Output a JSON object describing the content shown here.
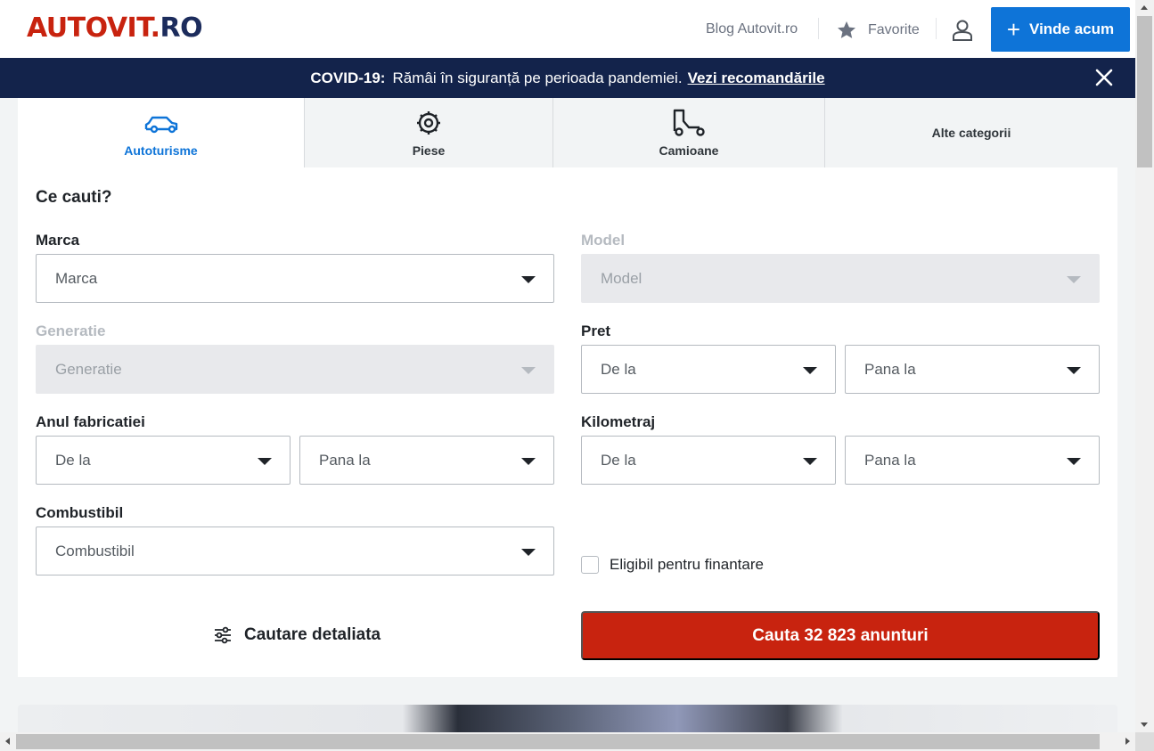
{
  "header": {
    "logo_part1": "AUTOVIT.",
    "logo_part2": "RO",
    "blog_link": "Blog Autovit.ro",
    "favorites": "Favorite",
    "sell_button": "Vinde acum",
    "sell_icon": "plus-icon",
    "favorites_icon": "star-icon",
    "account_icon": "user-icon"
  },
  "banner": {
    "label": "COVID-19:",
    "text": "Rămâi în siguranță pe perioada pandemiei.",
    "link": "Vezi recomandările",
    "close_icon": "close-icon"
  },
  "tabs": [
    {
      "label": "Autoturisme",
      "icon": "car-icon",
      "active": true
    },
    {
      "label": "Piese",
      "icon": "gear-icon",
      "active": false
    },
    {
      "label": "Camioane",
      "icon": "truck-icon",
      "active": false
    },
    {
      "label": "Alte categorii",
      "icon": "",
      "active": false
    }
  ],
  "form": {
    "title": "Ce cauti?",
    "make": {
      "label": "Marca",
      "value": "Marca"
    },
    "model": {
      "label": "Model",
      "value": "Model"
    },
    "generation": {
      "label": "Generatie",
      "value": "Generatie"
    },
    "price": {
      "label": "Pret",
      "from": "De la",
      "to": "Pana la"
    },
    "year": {
      "label": "Anul fabricatiei",
      "from": "De la",
      "to": "Pana la"
    },
    "mileage": {
      "label": "Kilometraj",
      "from": "De la",
      "to": "Pana la"
    },
    "fuel": {
      "label": "Combustibil",
      "value": "Combustibil"
    },
    "financing": {
      "label": "Eligibil pentru finantare",
      "checked": false
    },
    "advanced": "Cautare detaliata",
    "search_button": "Cauta 32 823 anunturi"
  },
  "colors": {
    "brand_red": "#c8230f",
    "brand_navy": "#13234b",
    "accent_blue": "#0e74d8"
  }
}
